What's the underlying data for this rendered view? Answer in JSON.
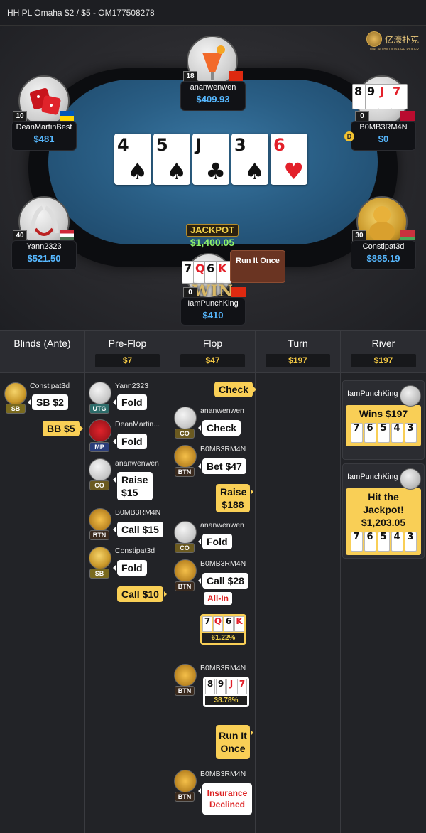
{
  "header": {
    "title": "HH PL Omaha $2 / $5  - OM177508278"
  },
  "brand": {
    "name": "亿濠扑克",
    "sub": "MACAU BILLIONAIRE POKER"
  },
  "table": {
    "board": [
      {
        "rank": "4",
        "suit": "♠",
        "color": "blk"
      },
      {
        "rank": "5",
        "suit": "♠",
        "color": "blk"
      },
      {
        "rank": "J",
        "suit": "♣",
        "color": "blk"
      },
      {
        "rank": "3",
        "suit": "♠",
        "color": "blk"
      },
      {
        "rank": "6",
        "suit": "♥",
        "color": "red"
      }
    ],
    "jackpot_label": "JACKPOT",
    "jackpot_value": "$1,400.05",
    "run_it_label": "Run It Once",
    "win_label": "WIN",
    "dealer_label": "D"
  },
  "players": [
    {
      "name": "ananwenwen",
      "stack": "$409.93",
      "level": "18"
    },
    {
      "name": "DeanMartinBest",
      "stack": "$481",
      "level": "10"
    },
    {
      "name": "B0MB3RM4N",
      "stack": "$0",
      "level": "0"
    },
    {
      "name": "Yann2323",
      "stack": "$521.50",
      "level": "40"
    },
    {
      "name": "Constipat3d",
      "stack": "$885.19",
      "level": "30"
    },
    {
      "name": "IamPunchKing",
      "stack": "$410",
      "level": "0"
    }
  ],
  "b0mb_cards": [
    "8",
    "9",
    "J",
    "7"
  ],
  "hero_cards": [
    "7",
    "Q",
    "6",
    "K"
  ],
  "history": {
    "columns": [
      {
        "title": "Blinds (Ante)",
        "pot": ""
      },
      {
        "title": "Pre-Flop",
        "pot": "$7"
      },
      {
        "title": "Flop",
        "pot": "$47"
      },
      {
        "title": "Turn",
        "pot": "$197"
      },
      {
        "title": "River",
        "pot": "$197"
      }
    ],
    "blinds": {
      "p1_name": "Constipat3d",
      "p1_pos": "SB",
      "p1_action": "SB  $2",
      "hero_action": "BB  $5"
    },
    "preflop": [
      {
        "name": "Yann2323",
        "pos": "UTG",
        "action": "Fold"
      },
      {
        "name": "DeanMartin...",
        "pos": "MP",
        "action": "Fold"
      },
      {
        "name": "ananwenwen",
        "pos": "CO",
        "action": "Raise $15"
      },
      {
        "name": "B0MB3RM4N",
        "pos": "BTN",
        "action": "Call  $15"
      },
      {
        "name": "Constipat3d",
        "pos": "SB",
        "action": "Fold"
      }
    ],
    "preflop_hero": "Call  $10",
    "flop": {
      "hero_check": "Check",
      "a1": {
        "name": "ananwenwen",
        "pos": "CO",
        "action": "Check"
      },
      "a2": {
        "name": "B0MB3RM4N",
        "pos": "BTN",
        "action": "Bet  $47"
      },
      "hero_raise": "Raise $188",
      "a3": {
        "name": "ananwenwen",
        "pos": "CO",
        "action": "Fold"
      },
      "a4": {
        "name": "B0MB3RM4N",
        "pos": "BTN",
        "action": "Call  $28",
        "tag": "All-In"
      },
      "hero_equity": "61.22%",
      "a5": {
        "name": "B0MB3RM4N",
        "pos": "BTN",
        "equity": "38.78%"
      },
      "hero_run": "Run It Once",
      "a6": {
        "name": "B0MB3RM4N",
        "pos": "BTN",
        "action": "Insurance Declined"
      }
    },
    "river": [
      {
        "name": "IamPunchKing",
        "title": "Wins $197",
        "cards": [
          "7",
          "6",
          "5",
          "4",
          "3"
        ]
      },
      {
        "name": "IamPunchKing",
        "title": "Hit the Jackpot! $1,203.05",
        "cards": [
          "7",
          "6",
          "5",
          "4",
          "3"
        ]
      }
    ]
  },
  "colors": {
    "accent": "#f9cf56",
    "stack": "#57b8ff",
    "jackpot": "#8ef06a"
  }
}
